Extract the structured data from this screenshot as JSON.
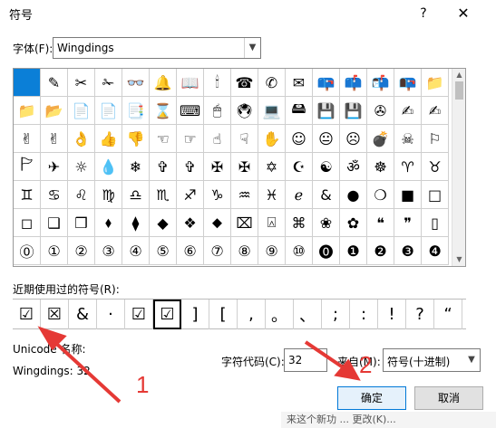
{
  "title": "符号",
  "title_buttons": {
    "help": "?",
    "close": "✕"
  },
  "font": {
    "label": "字体(F):",
    "value": "Wingdings"
  },
  "grid_rows": [
    [
      "",
      "✎",
      "✂",
      "✁",
      "👓",
      "🔔",
      "📖",
      "🕯",
      "☎",
      "✆",
      "✉",
      "📪",
      "📫",
      "📬",
      "📭",
      "📁"
    ],
    [
      "📁",
      "📂",
      "📄",
      "📄",
      "📑",
      "⌛",
      "⌨",
      "🖱",
      "🖲",
      "💻",
      "🖴",
      "💾",
      "💾",
      "✇",
      "✍",
      "✍"
    ],
    [
      "✌",
      "✌",
      "👌",
      "👍",
      "👎",
      "☜",
      "☞",
      "☝",
      "☟",
      "✋",
      "☺",
      "😐",
      "☹",
      "💣",
      "☠",
      "⚐"
    ],
    [
      "🏱",
      "✈",
      "☼",
      "💧",
      "❄",
      "✞",
      "✞",
      "✠",
      "✠",
      "✡",
      "☪",
      "☯",
      "ॐ",
      "☸",
      "♈",
      "♉"
    ],
    [
      "♊",
      "♋",
      "♌",
      "♍",
      "♎",
      "♏",
      "♐",
      "♑",
      "♒",
      "♓",
      "ℯ",
      "&",
      "●",
      "❍",
      "■",
      "□"
    ],
    [
      "◻",
      "❑",
      "❒",
      "⬧",
      "⧫",
      "◆",
      "❖",
      "⬥",
      "⌧",
      "⍓",
      "⌘",
      "❀",
      "✿",
      "❝",
      "❞",
      "▯"
    ],
    [
      "⓪",
      "①",
      "②",
      "③",
      "④",
      "⑤",
      "⑥",
      "⑦",
      "⑧",
      "⑨",
      "⑩",
      "⓿",
      "❶",
      "❷",
      "❸",
      "❹"
    ]
  ],
  "recent": {
    "label": "近期使用过的符号(R):",
    "symbols": [
      "☑",
      "☒",
      "&",
      "·",
      "☑",
      "☑",
      "]",
      "[",
      ",",
      "。",
      "、",
      ";",
      ":",
      "!",
      "?",
      "“"
    ]
  },
  "unicode_name_label": "Unicode 名称:",
  "wingdings_info": "Wingdings: 32",
  "char_code": {
    "label": "字符代码(C):",
    "value": "32"
  },
  "from": {
    "label": "来自(M):",
    "value": "符号(十进制)"
  },
  "buttons": {
    "ok": "确定",
    "cancel": "取消"
  },
  "annotations": {
    "marker1": "1",
    "marker2": "2",
    "color": "#e53935"
  },
  "selection_color": "#0b7fd7",
  "background_strip": "来这个新功 ... 更改(K)..."
}
